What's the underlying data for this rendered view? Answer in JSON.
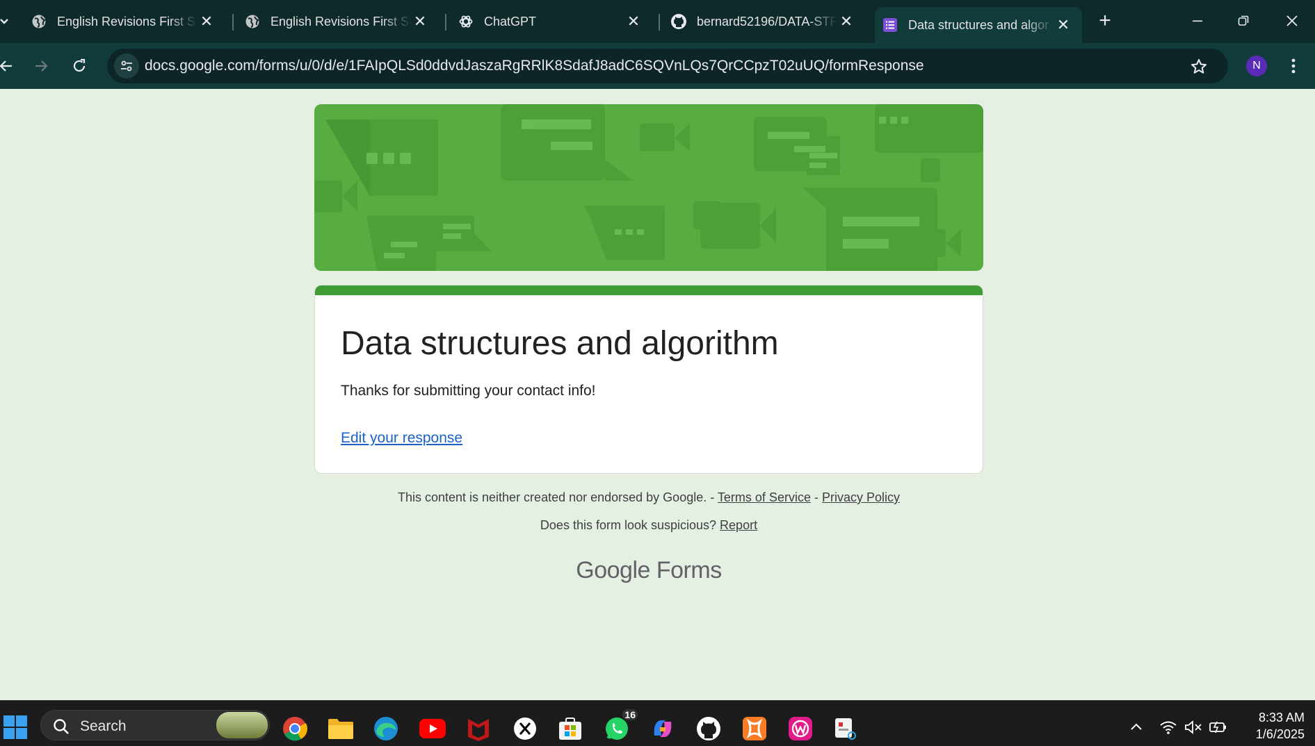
{
  "tabs": [
    {
      "title": "English Revisions First Se",
      "icon": "globe-icon",
      "active": false
    },
    {
      "title": "English Revisions First Se",
      "icon": "globe-icon",
      "active": false
    },
    {
      "title": "ChatGPT",
      "icon": "chatgpt-icon",
      "active": false
    },
    {
      "title": "bernard52196/DATA-STR",
      "icon": "github-icon",
      "active": false
    },
    {
      "title": "Data structures and algor",
      "icon": "google-forms-icon",
      "active": true
    }
  ],
  "toolbar": {
    "url": "docs.google.com/forms/u/0/d/e/1FAIpQLSd0ddvdJaszaRgRRlK8SdafJ8adC6SQVnLQs7QrCCpzT02uUQ/formResponse",
    "profile_initial": "N"
  },
  "form": {
    "title": "Data structures and algorithm",
    "message": "Thanks for submitting your contact info!",
    "edit_link": "Edit your response"
  },
  "footer": {
    "disclaimer": "This content is neither created nor endorsed by Google. -",
    "terms": "Terms of Service",
    "separator": "-",
    "privacy": "Privacy Policy",
    "suspicious": "Does this form look suspicious?",
    "report": "Report",
    "brand_google": "Google",
    "brand_forms": "Forms"
  },
  "taskbar": {
    "search_label": "Search",
    "whatsapp_badge": "16",
    "time": "8:33 AM",
    "date": "1/6/2025"
  },
  "colors": {
    "theme_green": "#57ad40",
    "card_accent": "#3f9c35",
    "page_bg": "#e5efe2",
    "link_blue": "#1a62c9"
  }
}
